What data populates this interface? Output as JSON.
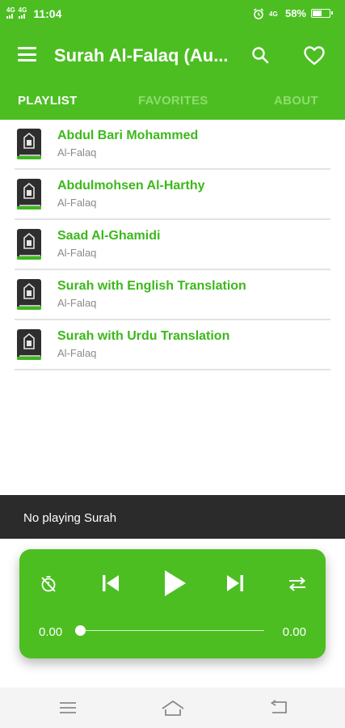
{
  "status_bar": {
    "network_1": "4G",
    "network_2": "4G",
    "time": "11:04",
    "battery_percent": "58%",
    "battery_level": 0.58
  },
  "app_bar": {
    "title": "Surah Al-Falaq (Au..."
  },
  "tabs": [
    {
      "label": "PLAYLIST",
      "active": true
    },
    {
      "label": "FAVORITES",
      "active": false
    },
    {
      "label": "ABOUT",
      "active": false
    }
  ],
  "playlist": [
    {
      "title": "Abdul Bari Mohammed",
      "subtitle": "Al-Falaq"
    },
    {
      "title": "Abdulmohsen Al-Harthy",
      "subtitle": "Al-Falaq"
    },
    {
      "title": "Saad Al-Ghamidi",
      "subtitle": "Al-Falaq"
    },
    {
      "title": "Surah with English Translation",
      "subtitle": "Al-Falaq"
    },
    {
      "title": "Surah with Urdu Translation",
      "subtitle": "Al-Falaq"
    }
  ],
  "now_playing": {
    "text": "No playing Surah"
  },
  "player": {
    "current_time": "0.00",
    "total_time": "0.00",
    "progress": 0
  },
  "colors": {
    "primary": "#4cbe22",
    "item_title": "#3cb81b",
    "now_playing_bg": "#2b2b2b"
  },
  "icons": {
    "menu": "menu-icon",
    "search": "search-icon",
    "favorite": "heart-icon",
    "item": "quran-book-icon",
    "timer": "timer-off-icon",
    "previous": "skip-previous-icon",
    "play": "play-icon",
    "next": "skip-next-icon",
    "repeat": "repeat-icon"
  }
}
